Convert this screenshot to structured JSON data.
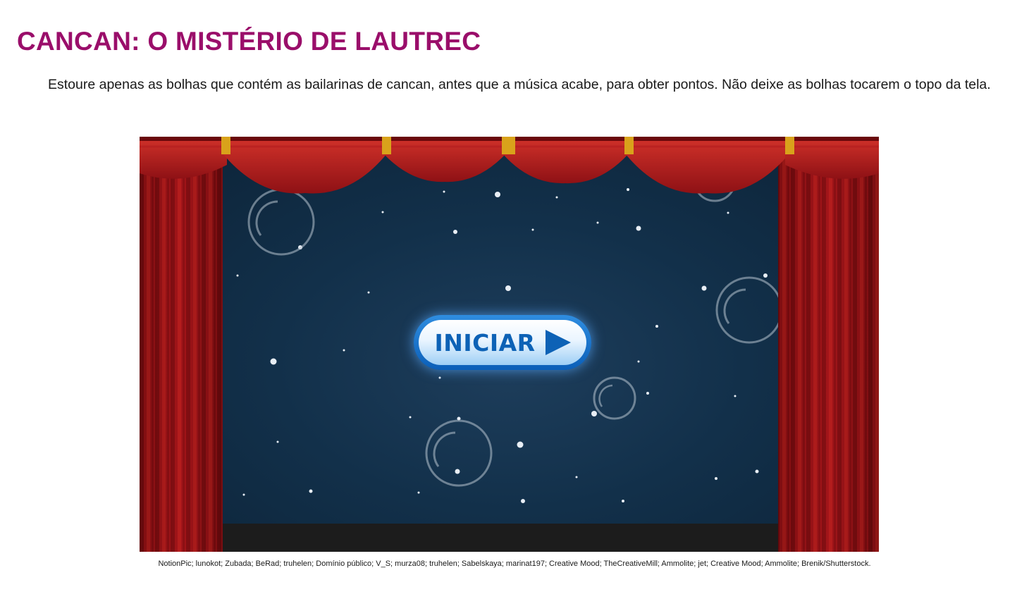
{
  "page": {
    "title": "CANCAN: O MISTÉRIO DE LAUTREC",
    "instructions": "Estoure apenas as bolhas que contém as bailarinas de cancan, antes que a música acabe, para obter pontos. Não deixe as bolhas tocarem o topo da tela."
  },
  "game": {
    "start_button": {
      "label": "INICIAR",
      "icon": "play-arrow-icon"
    }
  },
  "credits": "NotionPic; lunokot; Zubada; BeRad; truhelen; Domínio público; V_S; murza08; truhelen; Sabelskaya; marinat197; Creative Mood; TheCreativeMill; Ammolite; jet; Creative Mood; Ammolite; Brenik/Shutterstock.",
  "colors": {
    "title": "#9a0e6a",
    "curtain_red": "#a8161b",
    "valance_red": "#c42a24",
    "gold_tassel": "#d9a21b",
    "backdrop": "#12304a",
    "floor": "#1c1c1c",
    "button_blue": "#0d62b6"
  }
}
